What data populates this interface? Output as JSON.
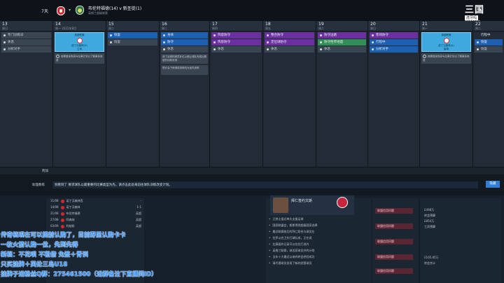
{
  "topbar": {
    "days": "7天",
    "match_title": "布伦特福德(14) v 新圣徒(1)",
    "match_sub": "英格兰超级联赛"
  },
  "logo": {
    "big": "三国",
    "box": "虎牙吗",
    "num": "3909115"
  },
  "calendar": {
    "columns": [
      {
        "date": "13",
        "weekday": "周日",
        "slots": [
          {
            "label": "专门训练日",
            "style": "grey"
          },
          {
            "label": "休息",
            "style": "grey"
          },
          {
            "label": "分析对手",
            "style": "grey"
          }
        ]
      },
      {
        "date": "14",
        "weekday": "周一 2022年8月",
        "match": {
          "title": "英超联赛",
          "versus": "诺丁汉森林(H)",
          "sub": "主场"
        },
        "note": "查看首发阵容与比赛计划以了解更多信息"
      },
      {
        "date": "15",
        "weekday": "周二",
        "slots": [
          {
            "label": "恢复",
            "style": "blue"
          },
          {
            "label": "恢复",
            "style": "grey"
          }
        ]
      },
      {
        "date": "16",
        "weekday": "周三",
        "slots": [
          {
            "label": "身体",
            "style": "blue"
          },
          {
            "label": "防守",
            "style": "blue"
          },
          {
            "label": "休息",
            "style": "grey"
          }
        ],
        "note": "请了足够的球员补位以便让球队完成比赛前的训练安排",
        "note2": "预计会下雨请将训练改为室内训练"
      },
      {
        "date": "17",
        "weekday": "周四",
        "slots": [
          {
            "label": "阵容防守",
            "style": "purple"
          },
          {
            "label": "阵容防守",
            "style": "purple"
          },
          {
            "label": "休息",
            "style": "grey"
          }
        ]
      },
      {
        "date": "18",
        "weekday": "周五",
        "slots": [
          {
            "label": "整合防守",
            "style": "purple"
          },
          {
            "label": "定位球防守",
            "style": "purple"
          },
          {
            "label": "休息",
            "style": "grey"
          }
        ]
      },
      {
        "date": "19",
        "weekday": "周六",
        "slots": [
          {
            "label": "防守边路",
            "style": "purple"
          },
          {
            "label": "防守性传地面",
            "style": "green"
          },
          {
            "label": "休息",
            "style": "grey"
          }
        ]
      },
      {
        "date": "20",
        "weekday": "周日",
        "slots": [
          {
            "label": "客场防守",
            "style": "purple"
          },
          {
            "label": "行程中",
            "style": "blue"
          },
          {
            "label": "分析对手",
            "style": "blue"
          }
        ]
      },
      {
        "date": "21",
        "weekday": "周一",
        "match": {
          "title": "英超联赛",
          "versus": "诺丁汉森林(A)",
          "sub": "客场"
        },
        "note": "查看首发阵容与比赛计划以了解更多信息"
      },
      {
        "date": "22",
        "weekday": "周二",
        "slots": [
          {
            "label": "行程中",
            "style": "plain"
          },
          {
            "label": "恢复",
            "style": "blue"
          },
          {
            "label": "恢复",
            "style": "grey"
          }
        ]
      }
    ]
  },
  "footer": {
    "label": "附加"
  },
  "advice": {
    "key": "助理教练",
    "text": "别看到了 要求球队以最重要的比赛类型为先，请点击此处来前往球队训练改变计划。",
    "button": "隐藏"
  },
  "fixtures": [
    {
      "date": "11/08",
      "team": "诺丁汉森林西",
      "score": "-"
    },
    {
      "date": "14/08",
      "team": "诺丁汉森林",
      "score": "1-1"
    },
    {
      "date": "21/08",
      "team": "布伦特福德",
      "score": "英超"
    },
    {
      "date": "27/08",
      "team": "阿森纳",
      "score": "英超"
    },
    {
      "date": "03/09",
      "team": "利兹联",
      "score": "英超"
    }
  ],
  "news": {
    "card_title": "拜仁签约文斯",
    "lines": [
      "已禁止接近单头支援足球",
      "国家联盟会，斯斯得到超级国家选择",
      "最近联赛前后的拜仁联合与球员在",
      "拉罗以合卫先打球队成，正在说",
      "比赛面的记录可以拉拉打进内",
      "英格兰联赛，球员获球员并的计划",
      "当年十大最近以来的转会经验成功",
      "清代理球员发现了新的经营球员"
    ]
  },
  "trades": [
    "联盟信用问题",
    "联盟信用问题",
    "联盟信用问题",
    "联盟信用问题",
    "联盟信用问题"
  ],
  "finance": [
    "£498万",
    "转会预算",
    "£854万",
    "工资预算",
    "£105.85万",
    "转会合计"
  ],
  "overlay": {
    "line1": "传奇档现在可以提前认购了，目前野里认购卡卡",
    "line2": "一枚火箭认购一位，先到先得",
    "line3": "新档：不花呗 不租借 免签＋青训",
    "line4": "只买挂牌＋英伦三岛U18",
    "line5": "挂牌子进粉丝Q群：275461500（进群备注下直播间ID）"
  }
}
